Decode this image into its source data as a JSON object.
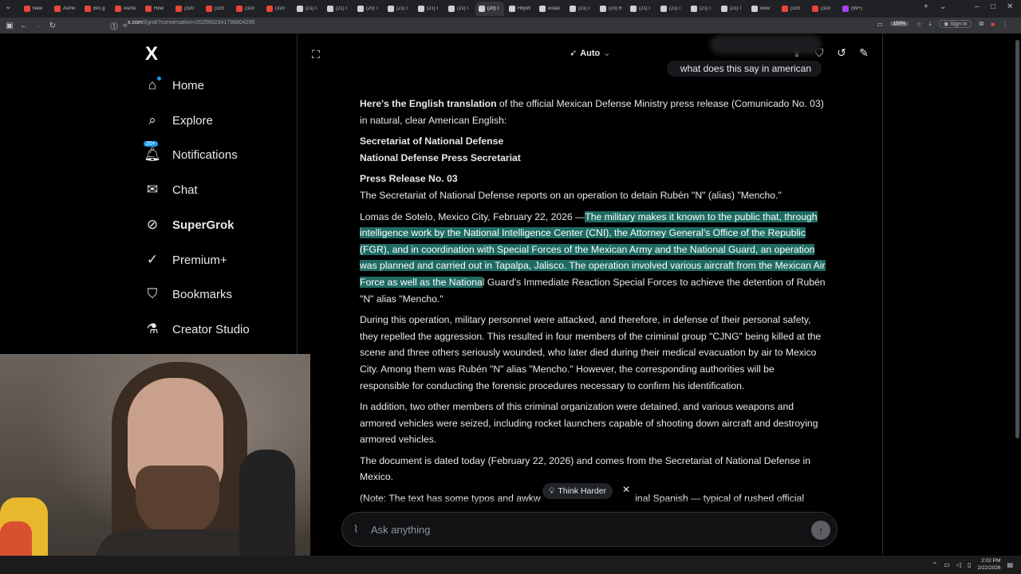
{
  "browser": {
    "tabs": [
      {
        "label": "New",
        "color": "#e8453c"
      },
      {
        "label": "Asmo",
        "color": "#e8453c"
      },
      {
        "label": "Bro g",
        "color": "#e8453c"
      },
      {
        "label": "Asmo",
        "color": "#e8453c"
      },
      {
        "label": "How",
        "color": "#e8453c"
      },
      {
        "label": "(320",
        "color": "#e8453c"
      },
      {
        "label": "(320",
        "color": "#e8453c"
      },
      {
        "label": "(320",
        "color": "#e8453c"
      },
      {
        "label": "(320",
        "color": "#e8453c"
      },
      {
        "label": "(21) I",
        "color": "#cfcfcf"
      },
      {
        "label": "(21) I",
        "color": "#cfcfcf"
      },
      {
        "label": "(20) T",
        "color": "#cfcfcf"
      },
      {
        "label": "(21) I",
        "color": "#cfcfcf"
      },
      {
        "label": "(21) I",
        "color": "#cfcfcf"
      },
      {
        "label": "(21) I",
        "color": "#cfcfcf"
      },
      {
        "label": "(20) I",
        "color": "#cfcfcf"
      },
      {
        "label": "H8yW",
        "color": "#cfcfcf"
      },
      {
        "label": "estad",
        "color": "#cfcfcf"
      },
      {
        "label": "(21) I",
        "color": "#cfcfcf"
      },
      {
        "label": "(20) R",
        "color": "#cfcfcf"
      },
      {
        "label": "(21) I",
        "color": "#cfcfcf"
      },
      {
        "label": "(21) I",
        "color": "#cfcfcf"
      },
      {
        "label": "(21) I",
        "color": "#cfcfcf"
      },
      {
        "label": "(21) I",
        "color": "#cfcfcf"
      },
      {
        "label": "wow",
        "color": "#cfcfcf"
      },
      {
        "label": "(320",
        "color": "#e8453c"
      },
      {
        "label": "(320",
        "color": "#e8453c"
      },
      {
        "label": "(99+)",
        "color": "#a142f4"
      }
    ],
    "url_host": "x.com",
    "url_path": "/i/grok?conversation=2025662341786804295",
    "zoom": "150%",
    "sign_in": "Sign in"
  },
  "sidebar": {
    "logo": "X",
    "items": [
      {
        "label": "Home",
        "icon": "home-icon"
      },
      {
        "label": "Explore",
        "icon": "search-icon"
      },
      {
        "label": "Notifications",
        "icon": "bell-icon",
        "badge": "20+"
      },
      {
        "label": "Chat",
        "icon": "mail-icon"
      },
      {
        "label": "SuperGrok",
        "icon": "grok-icon"
      },
      {
        "label": "Premium+",
        "icon": "verified-icon"
      },
      {
        "label": "Bookmarks",
        "icon": "bookmark-icon"
      },
      {
        "label": "Creator Studio",
        "icon": "flask-icon"
      }
    ]
  },
  "chat_header": {
    "model": "Auto"
  },
  "user_message": "what does this say in american",
  "response": {
    "intro_bold": "Here's the English translation",
    "intro_rest": " of the official Mexican Defense Ministry press release (Comunicado No. 03) in natural, clear American English:",
    "heading1": "Secretariat of National Defense",
    "heading2": "National Defense Press Secretariat",
    "release_no": "Press Release No. 03",
    "summary": "The Secretariat of National Defense reports on an operation to detain Rubén \"N\" (alias) \"Mencho.\"",
    "p1_start": "Lomas de Sotelo, Mexico City, February 22, 2026 —",
    "p1_highlight": "The military makes it known to the public that, through intelligence work by the National Intelligence Center (CNI), the Attorney General's Office of the Republic (FGR), and in coordination with Special Forces of the Mexican Army and the National Guard, an operation was planned and carried out in Tapalpa, Jalisco. The operation involved various aircraft from the Mexican Air Force as well as the Nationa",
    "p1_end": "l Guard's Immediate Reaction Special Forces to achieve the detention of Rubén \"N\" alias \"Mencho.\"",
    "p2": "During this operation, military personnel were attacked, and therefore, in defense of their personal safety, they repelled the aggression. This resulted in four members of the criminal group \"CJNG\" being killed at the scene and three others seriously wounded, who later died during their medical evacuation by air to Mexico City. Among them was Rubén \"N\" alias \"Mencho.\" However, the corresponding authorities will be responsible for conducting the forensic procedures necessary to confirm his identification.",
    "p3": "In addition, two other members of this criminal organization were detained, and various weapons and armored vehicles were seized, including rocket launchers capable of shooting down aircraft and destroying armored vehicles.",
    "p4": "The document is dated today (February 22, 2026) and comes from the Secretariat of National Defense in Mexico.",
    "p5": "(Note: The text has some typos and awkw                                   inal Spanish — typical of rushed official"
  },
  "think_harder": "Think Harder",
  "input": {
    "placeholder": "Ask anything"
  },
  "taskbar": {
    "time": "2:02 PM",
    "date": "2/22/2026"
  },
  "colors": {
    "highlight": "#1f6b63",
    "accent": "#1d9bf0",
    "background": "#000000"
  }
}
